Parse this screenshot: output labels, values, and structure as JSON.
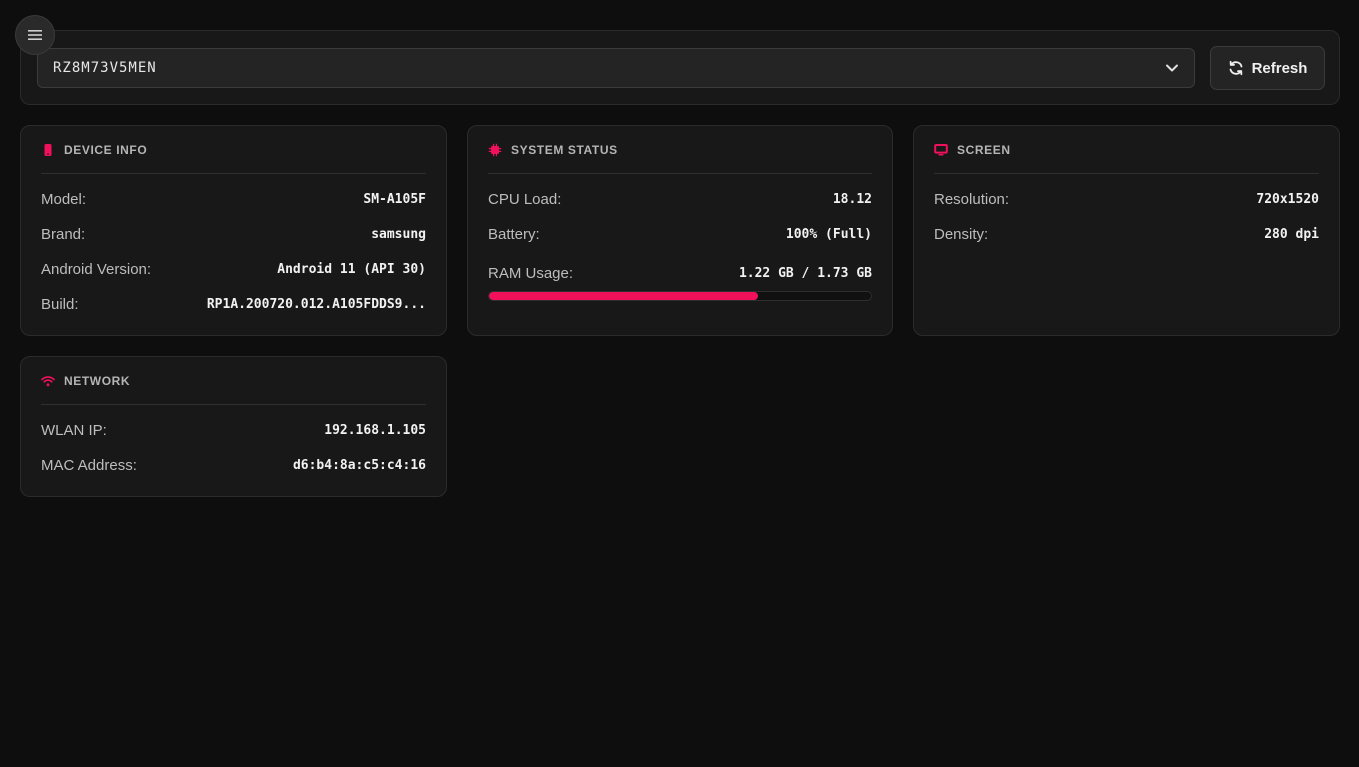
{
  "device_selector": {
    "selected": "RZ8M73V5MEN"
  },
  "toolbar": {
    "refresh_label": "Refresh"
  },
  "colors": {
    "accent": "#f0115a",
    "background": "#0e0e0e",
    "card": "#181818"
  },
  "device_info": {
    "title": "DEVICE INFO",
    "icon": "phone-icon",
    "rows": [
      {
        "label": "Model:",
        "value": "SM-A105F"
      },
      {
        "label": "Brand:",
        "value": "samsung"
      },
      {
        "label": "Android Version:",
        "value": "Android 11 (API 30)"
      },
      {
        "label": "Build:",
        "value": "RP1A.200720.012.A105FDDS9..."
      }
    ]
  },
  "system_status": {
    "title": "SYSTEM STATUS",
    "icon": "cpu-icon",
    "rows": [
      {
        "label": "CPU Load:",
        "value": "18.12"
      },
      {
        "label": "Battery:",
        "value": "100% (Full)"
      }
    ],
    "ram": {
      "label": "RAM Usage:",
      "value": "1.22 GB / 1.73 GB",
      "fraction": 0.705
    }
  },
  "screen": {
    "title": "SCREEN",
    "icon": "monitor-icon",
    "rows": [
      {
        "label": "Resolution:",
        "value": "720x1520"
      },
      {
        "label": "Density:",
        "value": "280 dpi"
      }
    ]
  },
  "network": {
    "title": "NETWORK",
    "icon": "wifi-icon",
    "rows": [
      {
        "label": "WLAN IP:",
        "value": "192.168.1.105"
      },
      {
        "label": "MAC Address:",
        "value": "d6:b4:8a:c5:c4:16"
      }
    ]
  }
}
